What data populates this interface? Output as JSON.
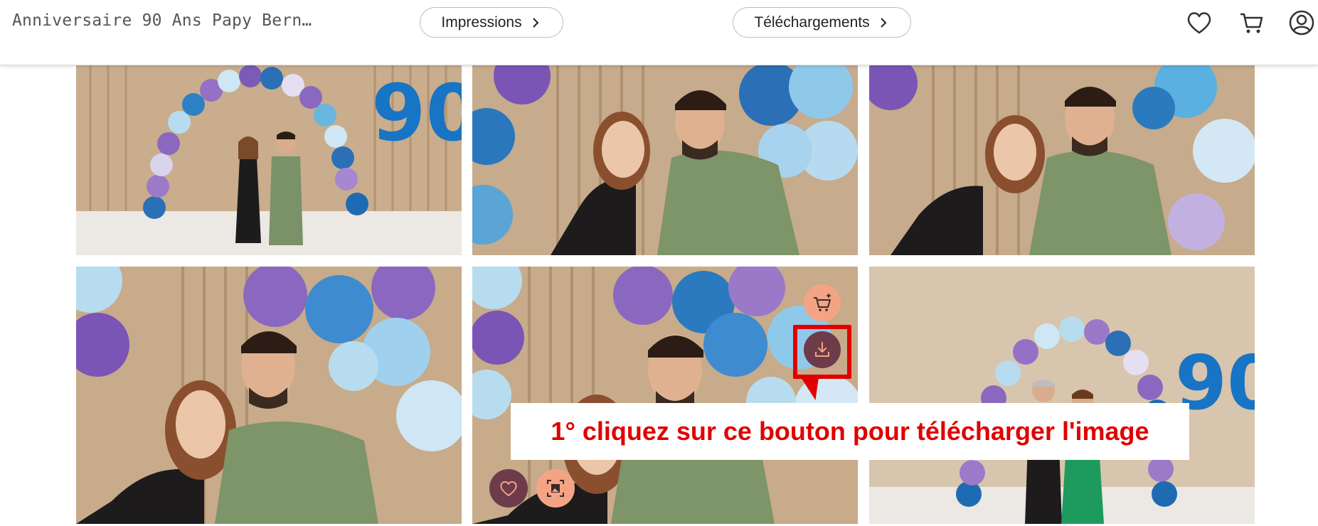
{
  "header": {
    "title": "Anniversaire 90 Ans Papy Bern…",
    "prints_label": "Impressions",
    "downloads_label": "Téléchargements",
    "icons": [
      "heart-icon",
      "cart-icon",
      "user-icon"
    ]
  },
  "gallery": {
    "photos": [
      {
        "name": "photo-1"
      },
      {
        "name": "photo-2"
      },
      {
        "name": "photo-3"
      },
      {
        "name": "photo-4"
      },
      {
        "name": "photo-5"
      },
      {
        "name": "photo-6"
      }
    ],
    "overlay_buttons": [
      "add-to-cart-icon",
      "download-icon",
      "favorite-icon",
      "frame-icon"
    ]
  },
  "annotation": {
    "text": "1° cliquez sur ce bouton pour télécharger l'image",
    "color": "#e00000"
  },
  "colors": {
    "accent_peach": "#f4a484",
    "accent_plum": "#6d3b4a"
  }
}
